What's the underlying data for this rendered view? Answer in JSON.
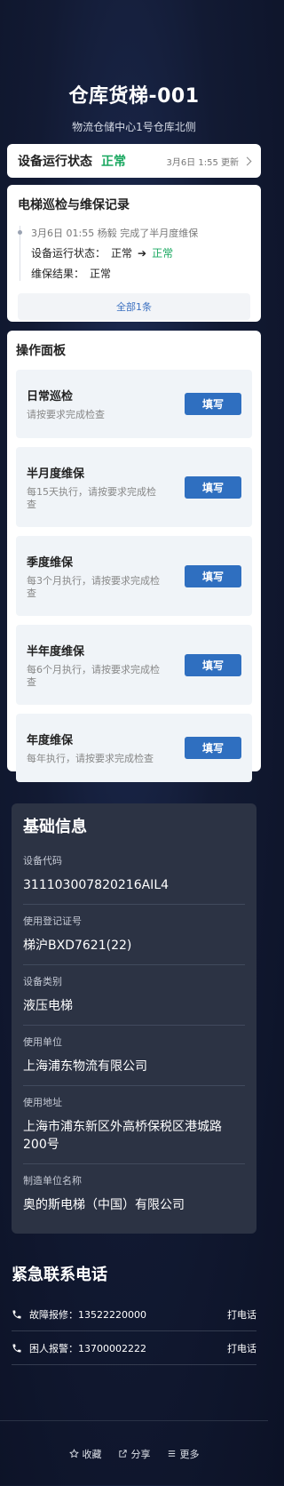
{
  "header": {
    "title": "仓库货梯-001",
    "subtitle": "物流仓储中心1号仓库北侧"
  },
  "status": {
    "label": "设备运行状态",
    "value": "正常",
    "updated": "3月6日 1:55 更新"
  },
  "record": {
    "title": "电梯巡检与维保记录",
    "entry_time_user": "3月6日 01:55  杨毅",
    "entry_action": "完成了半月度维保",
    "status_label": "设备运行状态：",
    "status_from": "正常",
    "status_to": "正常",
    "result_label": "维保结果：",
    "result_value": "正常",
    "all_link": "全部1条"
  },
  "panel": {
    "title": "操作面板",
    "items": [
      {
        "title": "日常巡检",
        "desc": "请按要求完成检查",
        "button": "填写"
      },
      {
        "title": "半月度维保",
        "desc": "每15天执行，请按要求完成检查",
        "button": "填写"
      },
      {
        "title": "季度维保",
        "desc": "每3个月执行，请按要求完成检查",
        "button": "填写"
      },
      {
        "title": "半年度维保",
        "desc": "每6个月执行，请按要求完成检查",
        "button": "填写"
      },
      {
        "title": "年度维保",
        "desc": "每年执行，请按要求完成检查",
        "button": "填写"
      }
    ]
  },
  "info": {
    "title": "基础信息",
    "rows": [
      {
        "label": "设备代码",
        "value": "311103007820216AIL4"
      },
      {
        "label": "使用登记证号",
        "value": "梯沪BXD7621(22)"
      },
      {
        "label": "设备类别",
        "value": "液压电梯"
      },
      {
        "label": "使用单位",
        "value": "上海浦东物流有限公司"
      },
      {
        "label": "使用地址",
        "value": "上海市浦东新区外高桥保税区港城路200号"
      },
      {
        "label": "制造单位名称",
        "value": "奥的斯电梯（中国）有限公司"
      }
    ]
  },
  "emergency": {
    "title": "紧急联系电话",
    "rows": [
      {
        "text": "故障报修：13522220000",
        "action": "打电话"
      },
      {
        "text": "困人报警：13700002222",
        "action": "打电话"
      }
    ]
  },
  "footer": {
    "favorite": "收藏",
    "share": "分享",
    "more": "更多"
  },
  "colors": {
    "accent": "#2f6fc0",
    "ok": "#1aa860"
  }
}
